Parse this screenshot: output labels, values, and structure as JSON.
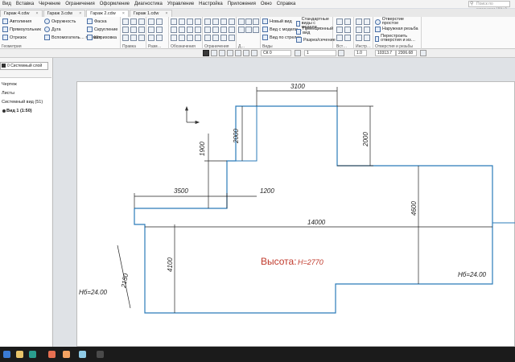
{
  "menu": [
    "Вид",
    "Вставка",
    "Черчение",
    "Ограничения",
    "Оформление",
    "Диагностика",
    "Управление",
    "Настройка",
    "Приложения",
    "Окно",
    "Справка"
  ],
  "search_placeholder": "Поиск по командам (Alt+/)",
  "tabs": [
    {
      "label": "Гараж 4.cdw"
    },
    {
      "label": "Гараж 3.cdw"
    },
    {
      "label": "Гараж 2.cdw"
    },
    {
      "label": "Гараж 1.cdw"
    }
  ],
  "ribbon": {
    "geometry": {
      "buttons": [
        "Автолиния",
        "Прямоугольник",
        "Отрезок",
        "Окружность",
        "Дуга",
        "Вспомогатель… прямая",
        "Фаска",
        "Скругление",
        "Штриховка"
      ],
      "label": "Геометрия"
    },
    "group_labels": [
      "Правка",
      "Разм…",
      "Обозначения",
      "Ограничения",
      "Д…",
      "Виды",
      "Вст…",
      "Инстр…",
      "Отверстия и резьбы"
    ],
    "views": {
      "buttons": [
        "Новый вид",
        "Вид с модели…",
        "Вид по стрелке",
        "Стандартные виды с модели…",
        "Проекционный вид",
        "Разрез/сечение"
      ]
    },
    "holes": {
      "buttons": [
        "Отверстие простое",
        "Наружная резьба",
        "Перестроить отверстия и из…"
      ]
    }
  },
  "bar2": {
    "layer": "СК 0",
    "view_num": "1",
    "scale": "1.0",
    "coord_x": "10313.7",
    "coord_y": "2306.68"
  },
  "left_panel": {
    "layer_label": "0  Системный слой",
    "tree": [
      "Чертеж",
      "Листы",
      "Системный вид (51)",
      "Вид 1 (1:50)"
    ]
  },
  "drawing": {
    "dims": [
      "3100",
      "2000",
      "2000",
      "1900",
      "2000",
      "3500",
      "1200",
      "14000",
      "4600",
      "4100",
      "2150",
      "Нб=24.00",
      "Нб=24.00"
    ],
    "height_label": "Высота:",
    "height_value": "H=2770"
  },
  "colors": {
    "outline": "#2b7bb9",
    "dim": "#222222",
    "height_text": "#c0392b"
  }
}
